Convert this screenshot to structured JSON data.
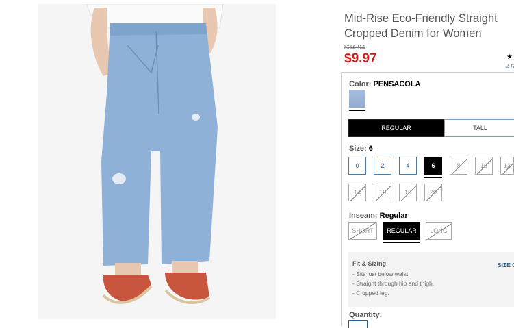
{
  "product": {
    "title": "Mid-Rise Eco-Friendly Straight Cropped Denim for Women",
    "old_price": "$34.94",
    "price": "$9.97",
    "rating_star": "★",
    "rating_value": "4.5"
  },
  "color": {
    "label": "Color:",
    "value": "PENSACOLA",
    "swatch_color": "#9fb6da"
  },
  "fit_tabs": [
    {
      "label": "REGULAR",
      "active": true
    },
    {
      "label": "TALL",
      "active": false
    }
  ],
  "size": {
    "label": "Size:",
    "value": "6",
    "options": [
      "0",
      "2",
      "4",
      "6",
      "8",
      "10",
      "12",
      "14",
      "16",
      "18",
      "20"
    ],
    "available": [
      "0",
      "2",
      "4",
      "6"
    ],
    "selected": "6"
  },
  "inseam": {
    "label": "Inseam:",
    "value": "Regular",
    "options": [
      "SHORT",
      "REGULAR",
      "LONG"
    ],
    "selected": "REGULAR"
  },
  "fit_sizing": {
    "title": "Fit & Sizing",
    "lines": [
      "- Sits just below waist.",
      "- Straight through hip and thigh.",
      "- Cropped leg."
    ],
    "size_chart_link": "SIZE C"
  },
  "quantity": {
    "label": "Quantity:"
  }
}
